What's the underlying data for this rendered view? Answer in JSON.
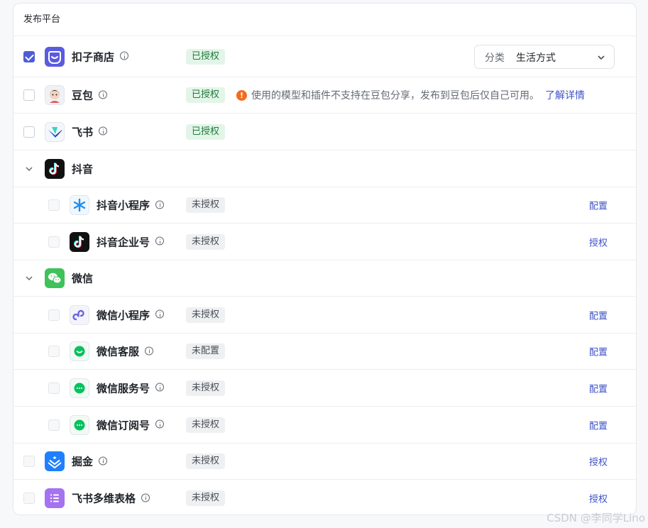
{
  "header": {
    "title": "发布平台"
  },
  "rows": [
    {
      "name": "扣子商店",
      "status": "已授权"
    },
    {
      "name": "豆包",
      "status": "已授权"
    },
    {
      "name": "飞书",
      "status": "已授权"
    },
    {
      "name": "抖音"
    },
    {
      "name": "抖音小程序",
      "status": "未授权",
      "action": "配置"
    },
    {
      "name": "抖音企业号",
      "status": "未授权",
      "action": "授权"
    },
    {
      "name": "微信"
    },
    {
      "name": "微信小程序",
      "status": "未授权",
      "action": "配置"
    },
    {
      "name": "微信客服",
      "status": "未配置",
      "action": "配置"
    },
    {
      "name": "微信服务号",
      "status": "未授权",
      "action": "配置"
    },
    {
      "name": "微信订阅号",
      "status": "未授权",
      "action": "配置"
    },
    {
      "name": "掘金",
      "status": "未授权",
      "action": "授权"
    },
    {
      "name": "飞书多维表格",
      "status": "未授权",
      "action": "授权"
    }
  ],
  "store_select": {
    "label": "分类",
    "value": "生活方式"
  },
  "doubao_warning": {
    "text": "使用的模型和插件不支持在豆包分享，发布到豆包后仅自己可用。",
    "link": "了解详情"
  },
  "icons": {
    "store": "kouzi-store-logo",
    "doubao": "doubao-logo",
    "feishu": "feishu-logo",
    "douyin": "douyin-logo",
    "wechat": "wechat-logo",
    "juejin": "juejin-logo",
    "bitable": "bitable-logo"
  },
  "colors": {
    "accent": "#4e5dd6",
    "link": "#3d52c9",
    "authorized_bg": "#e3f5e8",
    "warn": "#f26c1d"
  },
  "watermark": "CSDN @李同学Lino"
}
